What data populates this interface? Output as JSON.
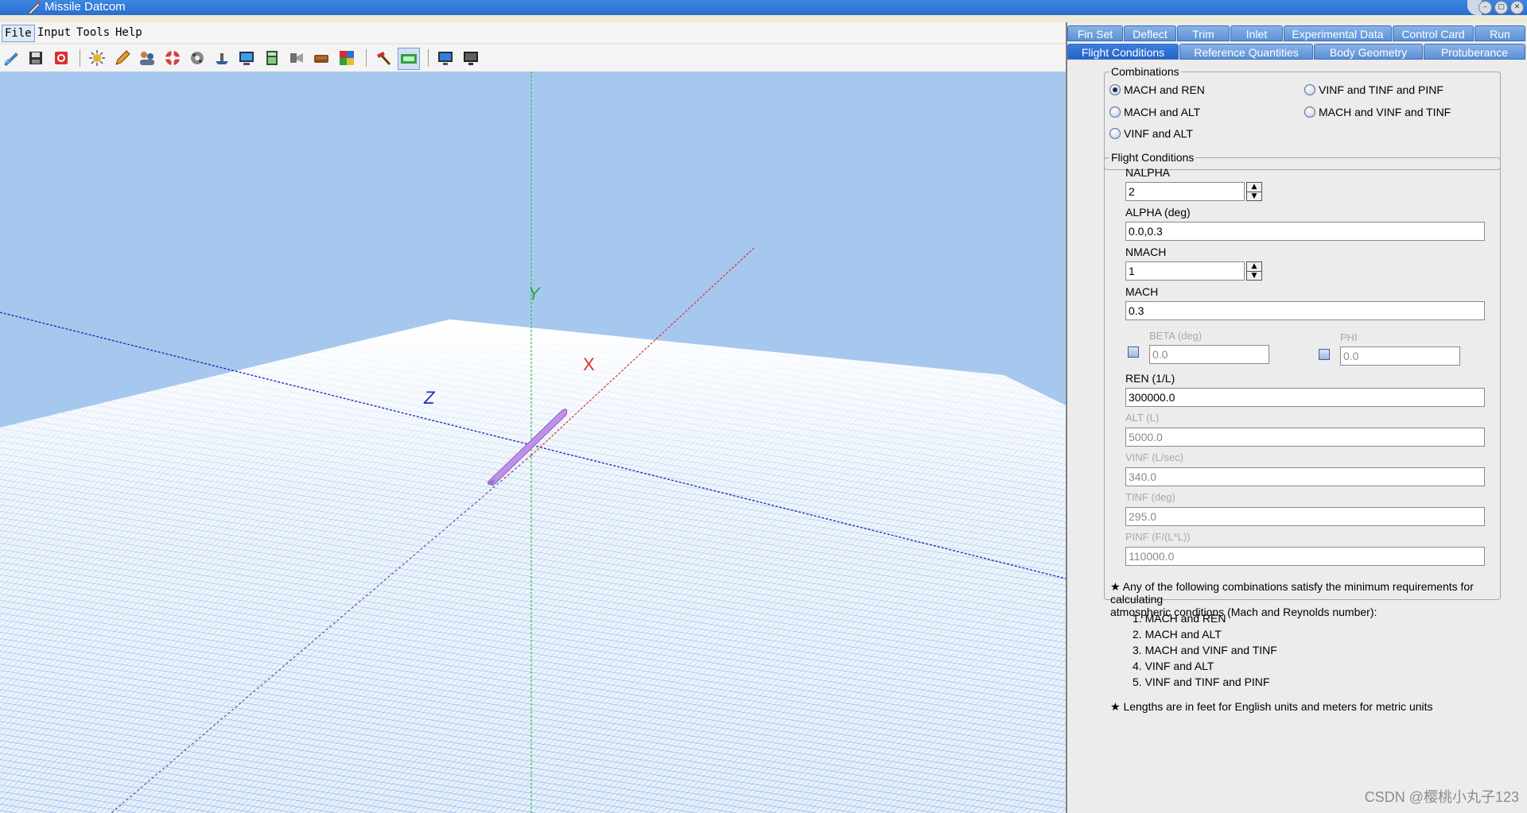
{
  "window": {
    "title": "Missile Datcom"
  },
  "menu": [
    {
      "label": "File"
    },
    {
      "label": "Input"
    },
    {
      "label": "Tools"
    },
    {
      "label": "Help"
    }
  ],
  "toolbar": {
    "icons": [
      "open-icon",
      "save-icon",
      "exit-icon",
      "sun-icon",
      "pencil-icon",
      "users-icon",
      "lifebuoy-icon",
      "gear-icon",
      "ship-icon",
      "monitor-icon",
      "calculator-icon",
      "brush-icon",
      "sofa-icon",
      "palette-icon",
      "hammer-icon",
      "grid-view-icon",
      "screen-icon",
      "display-icon"
    ]
  },
  "viewport": {
    "axis_labels": {
      "y": "Y",
      "x": "X",
      "z": "Z"
    },
    "colors": {
      "background": "#a6c8ee",
      "x_axis": "#e03030",
      "y_axis": "#30c050",
      "z_axis": "#2030c0",
      "missile": "#c090e8"
    }
  },
  "tabs": {
    "row1": [
      "Fin Set",
      "Deflect",
      "Trim",
      "Inlet",
      "Experimental Data",
      "Control Card",
      "Run"
    ],
    "row2": [
      "Flight Conditions",
      "Reference Quantities",
      "Body Geometry",
      "Protuberance"
    ],
    "active": "Flight Conditions"
  },
  "combinations": {
    "legend": "Combinations",
    "options": [
      "MACH and REN",
      "MACH and ALT",
      "VINF and ALT",
      "VINF and TINF and PINF",
      "MACH and VINF and TINF"
    ],
    "selected": "MACH and REN"
  },
  "flight": {
    "legend": "Flight Conditions",
    "nalpha": {
      "label": "NALPHA",
      "value": "2"
    },
    "alpha": {
      "label": "ALPHA  (deg)",
      "value": "0.0,0.3"
    },
    "nmach": {
      "label": "NMACH",
      "value": "1"
    },
    "mach": {
      "label": "MACH",
      "value": "0.3"
    },
    "beta": {
      "label": "BETA  (deg)",
      "value": "0.0"
    },
    "phi": {
      "label": "PHI",
      "value": "0.0"
    },
    "ren": {
      "label": "REN  (1/L)",
      "value": "300000.0"
    },
    "alt": {
      "label": "ALT  (L)",
      "value": "5000.0"
    },
    "vinf": {
      "label": "VINF  (L/sec)",
      "value": "340.0"
    },
    "tinf": {
      "label": "TINF  (deg)",
      "value": "295.0"
    },
    "pinf": {
      "label": "PINF  (F/(L*L))",
      "value": "110000.0"
    }
  },
  "notes": {
    "star1_line1": "★ Any of the following combinations satisfy the minimum requirements for calculating",
    "star1_line2": "atmospheric conditions (Mach and Reynolds number):",
    "list": [
      "1.  MACH and REN",
      "2.  MACH and ALT",
      "3.  MACH and VINF and TINF",
      "4.  VINF and ALT",
      "5.  VINF and TINF and PINF"
    ],
    "star2": "★ Lengths are in feet for English units and meters for metric units"
  },
  "watermark": "CSDN @樱桃小丸子123"
}
